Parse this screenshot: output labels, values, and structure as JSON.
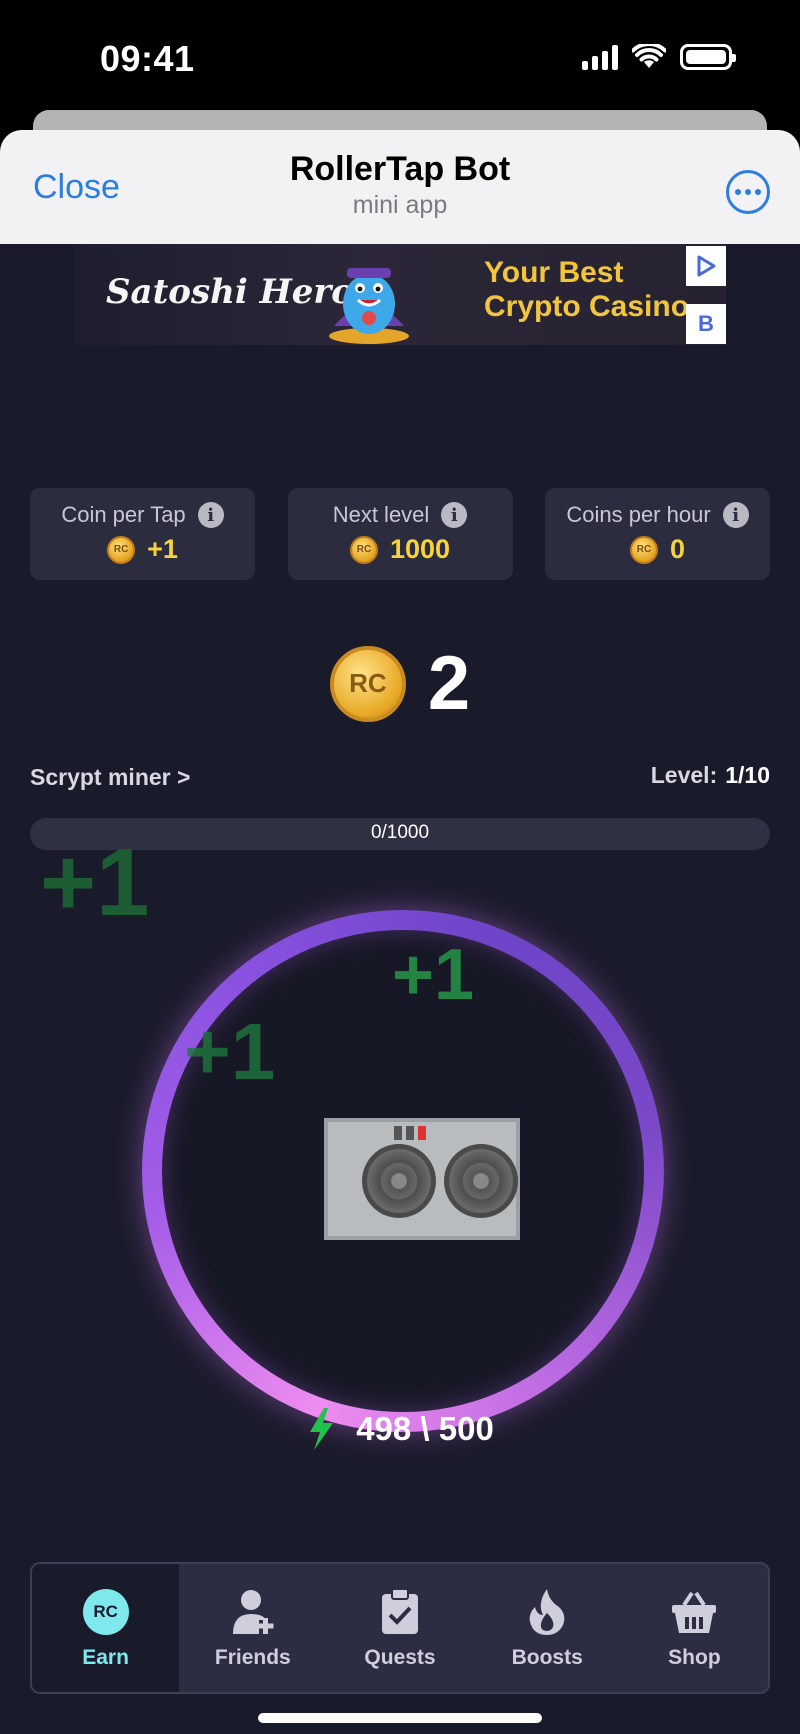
{
  "status_bar": {
    "time": "09:41"
  },
  "header": {
    "close_label": "Close",
    "title": "RollerTap Bot",
    "subtitle": "mini app",
    "more_icon": "ellipsis-circle-icon"
  },
  "ad": {
    "brand": "Satoshi Hero",
    "tagline_line1": "Your Best",
    "tagline_line2": "Crypto Casino",
    "b_label": "B"
  },
  "stats": [
    {
      "label": "Coin per Tap",
      "value": "+1"
    },
    {
      "label": "Next level",
      "value": "1000"
    },
    {
      "label": "Coins per hour",
      "value": "0"
    }
  ],
  "coin_symbol": "RC",
  "balance": "2",
  "miner": {
    "link_label": "Scrypt miner >",
    "level_label": "Level:",
    "level_value": "1/10"
  },
  "progress": {
    "text": "0/1000",
    "fraction": 0
  },
  "floating": [
    "+1",
    "+1",
    "+1"
  ],
  "energy": {
    "text": "498 \\ 500"
  },
  "nav": [
    {
      "label": "Earn",
      "icon": "rc-coin-icon",
      "active": true
    },
    {
      "label": "Friends",
      "icon": "add-user-icon"
    },
    {
      "label": "Quests",
      "icon": "clipboard-check-icon"
    },
    {
      "label": "Boosts",
      "icon": "flame-icon"
    },
    {
      "label": "Shop",
      "icon": "basket-icon"
    }
  ],
  "colors": {
    "accent_yellow": "#f7d23e",
    "nav_active": "#7ee8ec",
    "link_blue": "#2a7ee0",
    "ring_pink": "#ee8cf0",
    "ring_purple": "#8a52e0"
  }
}
